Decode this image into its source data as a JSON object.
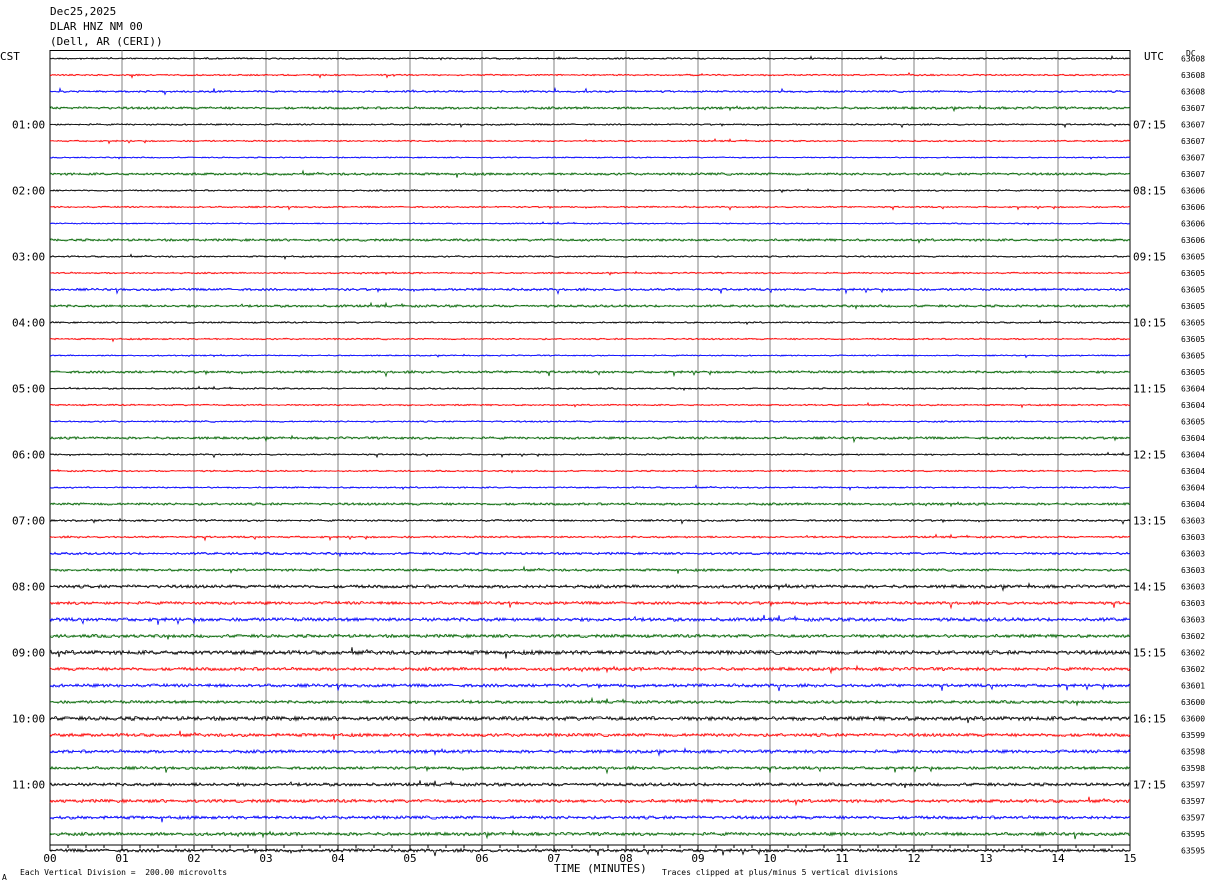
{
  "header": {
    "date": "Dec25,2025",
    "station": "DLAR HNZ NM 00",
    "location": "(Dell, AR (CERI))"
  },
  "left_zone_label": "CST",
  "right_zone_label": "UTC",
  "dc_label": "DC",
  "footer": {
    "scale_note": "Each Vertical Division =  200.00 microvolts",
    "xlabel": "TIME (MINUTES)",
    "clip_note": "Traces clipped at plus/minus 5 vertical divisions",
    "corner_mark": "A"
  },
  "colors": {
    "trace_cycle": [
      "#000000",
      "#ff0000",
      "#0000ff",
      "#006400"
    ],
    "grid_vertical": "#808080"
  },
  "chart_data": {
    "type": "line",
    "title": "DLAR HNZ NM 00",
    "xlabel": "TIME (MINUTES)",
    "ylabel": "",
    "xlim": [
      0,
      15
    ],
    "x_ticks": [
      "00",
      "01",
      "02",
      "03",
      "04",
      "05",
      "06",
      "07",
      "08",
      "09",
      "10",
      "11",
      "12",
      "13",
      "14",
      "15"
    ],
    "traces_per_hour": 4,
    "minutes_per_trace": 15,
    "cst_hour_labels": [
      "01:00",
      "02:00",
      "03:00",
      "04:00",
      "05:00",
      "06:00",
      "07:00",
      "08:00",
      "09:00",
      "10:00",
      "11:00"
    ],
    "utc_hour_labels": [
      "07:15",
      "08:15",
      "09:15",
      "10:15",
      "11:15",
      "12:15",
      "13:15",
      "14:15",
      "15:15",
      "16:15",
      "17:15"
    ],
    "dc_offsets": [
      63608,
      63608,
      63608,
      63607,
      63607,
      63607,
      63607,
      63607,
      63606,
      63606,
      63606,
      63606,
      63605,
      63605,
      63605,
      63605,
      63605,
      63605,
      63605,
      63605,
      63604,
      63604,
      63605,
      63604,
      63604,
      63604,
      63604,
      63604,
      63603,
      63603,
      63603,
      63603,
      63603,
      63603,
      63603,
      63602,
      63602,
      63602,
      63601,
      63600,
      63600,
      63599,
      63598,
      63598,
      63597,
      63597,
      63597,
      63595,
      63595
    ],
    "noise_level": [
      1.0,
      1.0,
      1.2,
      1.5,
      1.0,
      1.0,
      0.8,
      1.5,
      1.0,
      1.0,
      0.8,
      1.5,
      1.0,
      1.0,
      1.5,
      1.5,
      1.0,
      1.0,
      0.8,
      1.5,
      1.0,
      1.0,
      1.0,
      1.5,
      1.0,
      1.0,
      1.0,
      1.5,
      1.2,
      1.2,
      1.5,
      1.5,
      2.0,
      1.8,
      2.2,
      2.0,
      2.5,
      2.0,
      2.0,
      1.8,
      2.5,
      2.0,
      2.0,
      1.8,
      2.0,
      2.0,
      2.0,
      2.0,
      2.0
    ]
  }
}
